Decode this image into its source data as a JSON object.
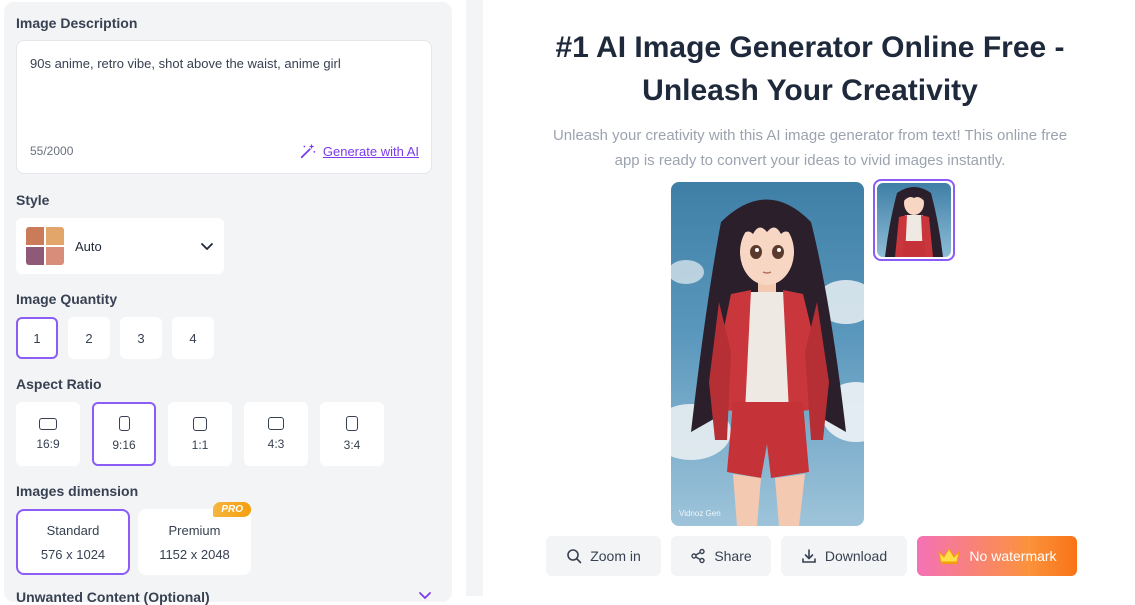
{
  "left": {
    "description": {
      "label": "Image Description",
      "text": "90s anime, retro vibe, shot above the waist, anime girl",
      "count": "55/2000",
      "generate_label": "Generate with AI"
    },
    "style": {
      "label": "Style",
      "selected": "Auto"
    },
    "quantity": {
      "label": "Image Quantity",
      "options": [
        "1",
        "2",
        "3",
        "4"
      ],
      "selected": "1"
    },
    "aspect": {
      "label": "Aspect Ratio",
      "options": [
        "16:9",
        "9:16",
        "1:1",
        "4:3",
        "3:4"
      ],
      "selected": "9:16"
    },
    "dimension": {
      "label": "Images dimension",
      "options": [
        {
          "name": "Standard",
          "size": "576 x 1024"
        },
        {
          "name": "Premium",
          "size": "1152 x 2048",
          "badge": "PRO"
        }
      ],
      "selected": "Standard"
    },
    "unwanted": {
      "label": "Unwanted Content (Optional)"
    }
  },
  "right": {
    "title_line1": "#1 AI Image Generator Online Free -",
    "title_line2": "Unleash Your Creativity",
    "subtitle_line1": "Unleash your creativity with this AI image generator from text! This online free",
    "subtitle_line2": "app is ready to convert your ideas to vivid images instantly.",
    "watermark": "Vidnoz Gen",
    "actions": {
      "zoom": "Zoom in",
      "share": "Share",
      "download": "Download",
      "no_watermark": "No watermark"
    }
  },
  "colors": {
    "accent": "#8b5cf6",
    "link": "#7c3aed",
    "title": "#1e293b",
    "muted": "#9ca3af"
  },
  "icons": [
    "magic-wand-icon",
    "chevron-down-icon",
    "search-icon",
    "share-icon",
    "download-icon",
    "crown-icon"
  ]
}
